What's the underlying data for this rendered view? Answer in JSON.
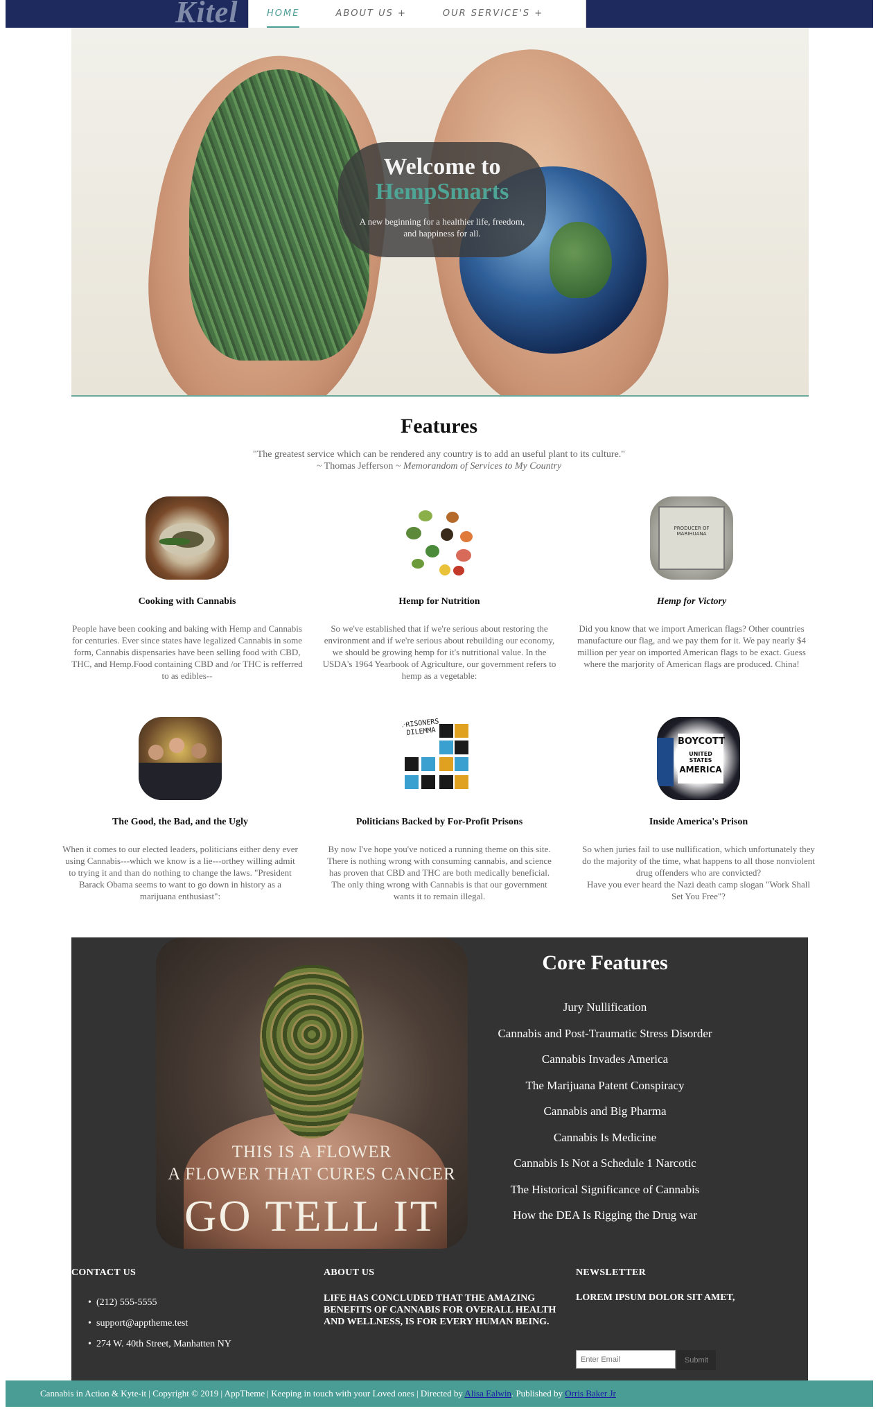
{
  "brand": {
    "logo_text": "Kitel"
  },
  "nav": [
    {
      "label": "HOME",
      "active": true
    },
    {
      "label": "ABOUT US +"
    },
    {
      "label": "OUR SERVICE'S +"
    }
  ],
  "hero": {
    "welcome_line1": "Welcome to",
    "welcome_line2": "HempSmarts",
    "tagline": "A new beginning for a healthier life, freedom, and happiness for all."
  },
  "features": {
    "title": "Features",
    "quote_line1": "\"The greatest service which can be rendered any country is to add an useful plant to its culture.\"",
    "quote_attrib": "~ Thomas Jefferson ~",
    "quote_source": "Memorandom of Services to My Country",
    "items": [
      {
        "icon": "cannabis-cooking-icon",
        "title": "Cooking with Cannabis",
        "text": "People have been cooking and baking with Hemp and Cannabis for centuries. Ever since states have legalized Cannabis in some form, Cannabis dispensaries have been selling food with CBD, THC, and Hemp.Food containing CBD and /or THC is refferred to as edibles--"
      },
      {
        "icon": "nutrition-chart-icon",
        "title": "Hemp for Nutrition",
        "text": "So we've established that if we're serious about restoring the environment and if we're serious about rebuilding our economy, we should be growing hemp for it's nutritional value. In the USDA's 1964 Yearbook of Agriculture, our government refers to hemp as a vegetable:"
      },
      {
        "icon": "marijuana-stamp-icon",
        "title": "Hemp for Victory",
        "text": "Did you know that we import American flags? Other countries manufacture our flag, and we pay them for it. We pay nearly $4 million per year on imported American flags to be exact. Guess where the marjority of American flags are produced. China!"
      },
      {
        "icon": "politicians-photo-icon",
        "title": "The Good, the Bad, and the Ugly",
        "text": "When it comes to our elected leaders, politicians either deny ever using Cannabis---which we know is a lie---orthey willing admit to trying it and than do nothing to change the laws. \"President Barack Obama seems to want to go down in history as a marijuana enthusiast\":"
      },
      {
        "icon": "prisoners-dilemma-icon",
        "title": "Politicians Backed by For-Profit Prisons",
        "text": "By now I've hope you've noticed a running theme on this site. There is nothing wrong with consuming cannabis, and science has proven that CBD and THC are both medically beneficial. The only thing wrong with Cannabis is that our government wants it to remain illegal."
      },
      {
        "icon": "boycott-america-icon",
        "title": "Inside America's Prison",
        "text": "So when juries fail to use nullification, which unfortunately they do the majority of the time, what happens to all those nonviolent drug offenders who are convicted?\nHave you ever heard the Nazi death camp slogan \"Work Shall Set You Free\"?"
      }
    ],
    "boycott_text": [
      "BOYCOTT",
      "UNITED STATES",
      "AMERICA"
    ],
    "dilemma_text": [
      "PRISONERS",
      "DILEMMA"
    ],
    "stamp_text": "PRODUCER OF MARIHUANA"
  },
  "core": {
    "title": "Core Features",
    "image_line1": "THIS IS A FLOWER",
    "image_line2": "A FLOWER THAT CURES CANCER",
    "image_line3": "GO TELL IT",
    "items": [
      "Jury Nullification",
      "Cannabis and Post-Traumatic Stress Disorder",
      "Cannabis Invades America",
      "The Marijuana Patent Conspiracy",
      "Cannabis and Big Pharma",
      "Cannabis Is Medicine",
      "Cannabis Is Not a Schedule 1 Narcotic",
      "The Historical Significance of Cannabis",
      "How the DEA Is Rigging the Drug war"
    ]
  },
  "footer": {
    "contact_heading": "CONTACT US",
    "phone": "(212) 555-5555",
    "email": "support@apptheme.test",
    "address": "274 W. 40th Street, Manhatten NY",
    "about_heading": "ABOUT US",
    "about_text": "LIFE HAS CONCLUDED THAT THE AMAZING BENEFITS OF CANNABIS FOR OVERALL HEALTH AND WELLNESS, IS FOR EVERY HUMAN BEING.",
    "newsletter_heading": "NEWSLETTER",
    "newsletter_text": "LOREM IPSUM DOLOR SIT AMET,",
    "email_placeholder": "Enter Email",
    "submit_label": "Submit"
  },
  "bottom_bar": {
    "text": "Cannabis in Action & Kyte-it | Copyright © 2019 | AppTheme | Keeping in touch with your Loved ones | Directed by ",
    "link1": "Alisa Ealwin",
    "mid": ". Published by ",
    "link2": "Orris Baker Jr"
  },
  "colors": {
    "nav_bg": "#1e2a5e",
    "accent": "#4a9d95",
    "dark_bg": "#333333"
  }
}
